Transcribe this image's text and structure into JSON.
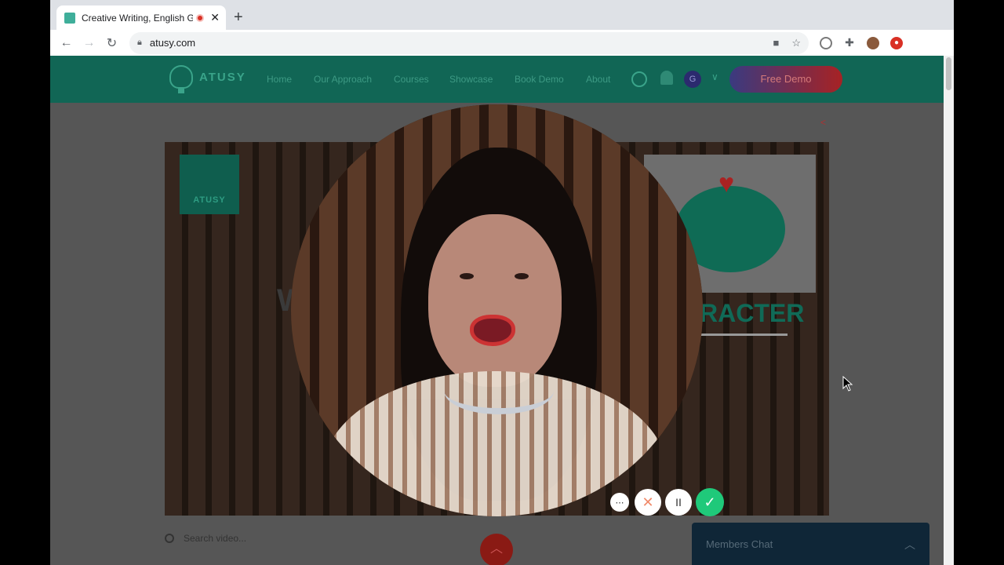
{
  "browser": {
    "tab_title": "Creative Writing, English G",
    "tab_close": "✕",
    "new_tab": "+",
    "url": "atusy.com",
    "nav_back": "←",
    "nav_forward": "→",
    "nav_reload": "↻"
  },
  "site": {
    "logo_text": "ATUSY",
    "nav": [
      "Home",
      "Our Approach",
      "Courses",
      "Showcase",
      "Book Demo",
      "About"
    ],
    "avatar_initial": "G",
    "cta": "Free Demo",
    "share": "<",
    "video": {
      "logo_text": "ATUSY",
      "word_left": "W",
      "word_right": "RACTER",
      "exclaim": "!"
    },
    "search_placeholder": "Search video...",
    "chat_label": "Members Chat",
    "chat_toggle": "︿"
  },
  "recorder": {
    "more": "⋯",
    "stop": "✕",
    "pause": "II",
    "done": "✓"
  },
  "colors": {
    "header_bg": "#116655",
    "cta_from": "#3a3a80",
    "cta_to": "#a72224",
    "record_done": "#1fc97a"
  }
}
